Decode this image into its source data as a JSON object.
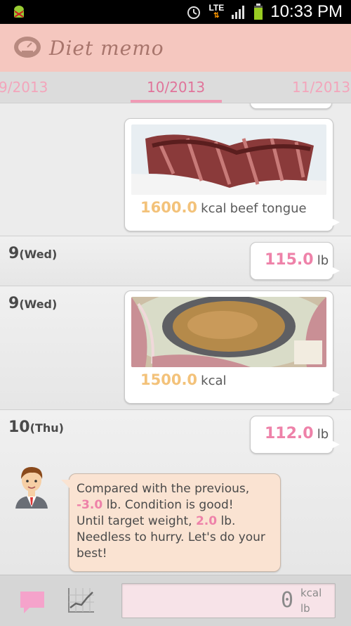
{
  "status_bar": {
    "time": "10:33 PM",
    "network": "LTE",
    "icons": [
      "android-debug-icon",
      "alarm-icon",
      "lte-icon",
      "signal-icon",
      "battery-icon"
    ]
  },
  "app": {
    "title": "Diet memo",
    "logo_icon": "scale-icon"
  },
  "month_nav": {
    "prev": "9/2013",
    "current": "10/2013",
    "next": "11/2013"
  },
  "entries": [
    {
      "kcal": "1600.0",
      "unit": "kcal",
      "note": "beef tongue",
      "photo": "beef-tongue-photo"
    },
    {
      "day": "9",
      "dow": "(Wed)",
      "weight": "115.0",
      "unit": "lb"
    },
    {
      "day": "9",
      "dow": "(Wed)",
      "kcal": "1500.0",
      "unit": "kcal",
      "note": "",
      "photo": "hotpot-photo"
    },
    {
      "day": "10",
      "dow": "(Thu)",
      "weight": "112.0",
      "unit": "lb"
    }
  ],
  "advice": {
    "line1": "Compared with the previous,",
    "delta": "-3.0",
    "line2_rest": " lb. Condition is good!",
    "line3_pre": "Until target weight, ",
    "target": "2.0",
    "line3_rest": " lb.",
    "line4": "Needless to hurry. Let's do your best!"
  },
  "input": {
    "value": "0",
    "unit_kcal": "kcal",
    "unit_lb": "lb"
  },
  "colors": {
    "header_bg": "#f5c7bf",
    "accent_pink": "#ee82a9",
    "kcal_yellow": "#f3c27a",
    "advice_bg": "#fae3d2"
  }
}
